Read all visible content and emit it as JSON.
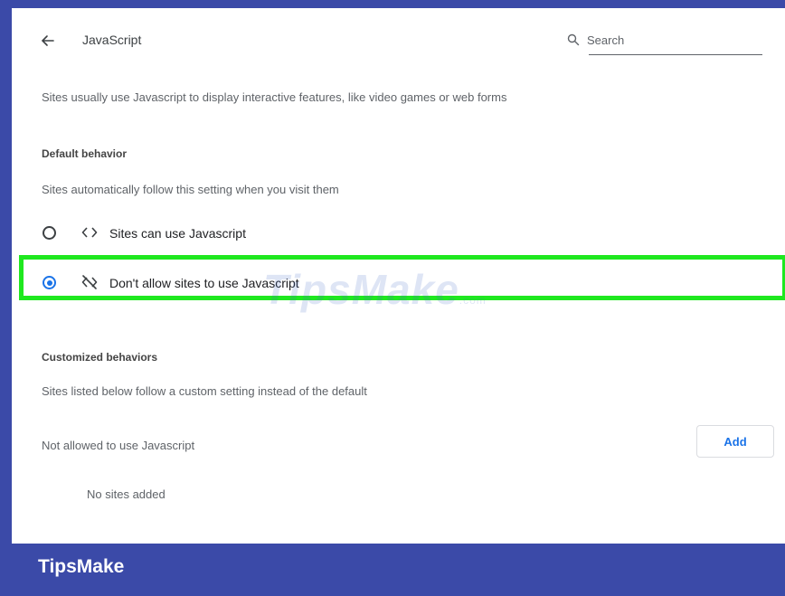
{
  "header": {
    "title": "JavaScript",
    "back_icon": "arrow-left-icon",
    "search": {
      "placeholder": "Search",
      "icon": "search-icon"
    }
  },
  "intro": "Sites usually use Javascript to display interactive features, like video games or web forms",
  "default_behavior": {
    "heading": "Default behavior",
    "description": "Sites automatically follow this setting when you visit them",
    "options": [
      {
        "label": "Sites can use Javascript",
        "icon": "code-brackets-icon",
        "selected": false
      },
      {
        "label": "Don't allow sites to use Javascript",
        "icon": "code-off-icon",
        "selected": true
      }
    ]
  },
  "customized": {
    "heading": "Customized behaviors",
    "description": "Sites listed below follow a custom setting instead of the default",
    "not_allowed_label": "Not allowed to use Javascript",
    "add_label": "Add",
    "empty_label": "No sites added"
  },
  "watermark": {
    "brand": "TipsMake",
    "suffix": ".com"
  },
  "footer": {
    "brand": "TipsMake"
  },
  "colors": {
    "frame": "#3b4aa8",
    "highlight": "#1fe81f",
    "accent": "#1a73e8"
  }
}
